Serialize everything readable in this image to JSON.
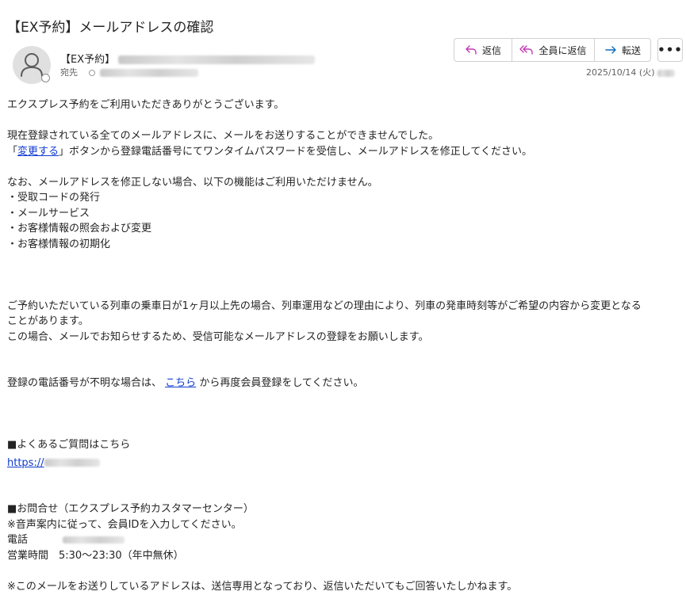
{
  "subject": "【EX予約】メールアドレスの確認",
  "sender": {
    "name": "【EX予約】"
  },
  "to_label": "宛先",
  "date": "2025/10/14 (火)",
  "toolbar": {
    "reply": "返信",
    "reply_all": "全員に返信",
    "forward": "転送",
    "more": "•••"
  },
  "icons": {
    "reply": "reply-icon",
    "reply_all": "reply-all-icon",
    "forward": "forward-icon",
    "more": "more-icon",
    "avatar": "person-icon"
  },
  "colors": {
    "link": "#0f3bcf",
    "reply_icon": "#c239b3",
    "forward_icon": "#0f6cbd"
  },
  "body": {
    "p1": "エクスプレス予約をご利用いただきありがとうございます。",
    "p2_line1": "現在登録されている全てのメールアドレスに、メールをお送りすることができませんでした。",
    "p2_prefix": "「",
    "p2_link": "変更する",
    "p2_rest": "」ボタンから登録電話番号にてワンタイムパスワードを受信し、メールアドレスを修正してください。",
    "p3_line1": "なお、メールアドレスを修正しない場合、以下の機能はご利用いただけません。",
    "bullets": [
      "・受取コードの発行",
      "・メールサービス",
      "・お客様情報の照会および変更",
      "・お客様情報の初期化"
    ],
    "p4_line1": "ご予約いただいている列車の乗車日が1ヶ月以上先の場合、列車運用などの理由により、列車の発車時刻等がご希望の内容から変更となる",
    "p4_line2": "ことがあります。",
    "p4_line3": "この場合、メールでお知らせするため、受信可能なメールアドレスの登録をお願いします。",
    "p5_prefix": "登録の電話番号が不明な場合は、",
    "p5_link": "こちら",
    "p5_rest": "から再度会員登録をしてください。",
    "faq_title": "■よくあるご質問はこちら",
    "faq_link": "https://",
    "contact_title": "■お問合せ（エクスプレス予約カスタマーセンター）",
    "contact_note": "※音声案内に従って、会員IDを入力してください。",
    "phone_label": "電話",
    "hours": "営業時間　5:30～23:30（年中無休）",
    "footer_note": "※このメールをお送りしているアドレスは、送信専用となっており、返信いただいてもご回答いたしかねます。"
  }
}
